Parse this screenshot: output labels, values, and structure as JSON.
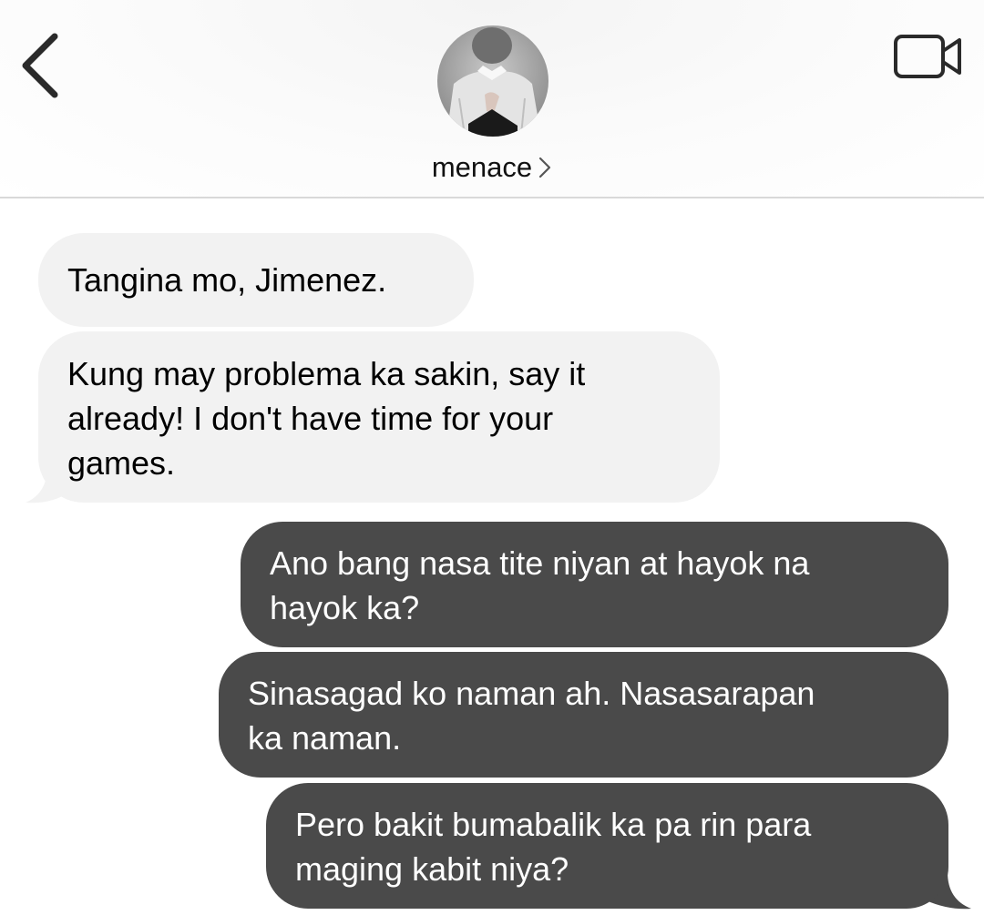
{
  "header": {
    "contact_name": "menace",
    "back_icon": "chevron-left-icon",
    "video_icon": "video-camera-icon"
  },
  "messages": [
    {
      "direction": "incoming",
      "text": "Tangina mo, Jimenez."
    },
    {
      "direction": "incoming",
      "text": "Kung may problema ka sakin, say it\nalready! I don't have time for your\ngames."
    },
    {
      "direction": "outgoing",
      "text": "Ano bang nasa tite niyan at hayok na\nhayok ka?"
    },
    {
      "direction": "outgoing",
      "text": "Sinasagad ko naman ah. Nasasarapan\nka naman."
    },
    {
      "direction": "outgoing",
      "text": "Pero bakit bumabalik ka pa rin para\nmaging kabit niya?"
    }
  ],
  "colors": {
    "incoming_bubble": "#f2f2f2",
    "outgoing_bubble": "#4a4a4a",
    "header_divider": "#d9d9d9"
  }
}
